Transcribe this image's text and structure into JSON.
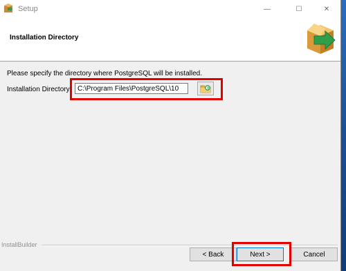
{
  "window": {
    "title": "Setup",
    "controls": {
      "minimize": "—",
      "maximize": "☐",
      "close": "✕"
    }
  },
  "header": {
    "title": "Installation Directory",
    "logo_icon": "package-install-icon"
  },
  "main": {
    "instruction": "Please specify the directory where PostgreSQL will be installed.",
    "directory_label": "Installation Directory",
    "directory_value": "C:\\Program Files\\PostgreSQL\\10",
    "browse_icon": "folder-browse-icon"
  },
  "footer": {
    "brand": "InstallBuilder",
    "back_label": "< Back",
    "next_label": "Next >",
    "cancel_label": "Cancel"
  },
  "colors": {
    "highlight": "#e00000",
    "accent": "#0078d7",
    "desktop": "#1e5fa8"
  }
}
